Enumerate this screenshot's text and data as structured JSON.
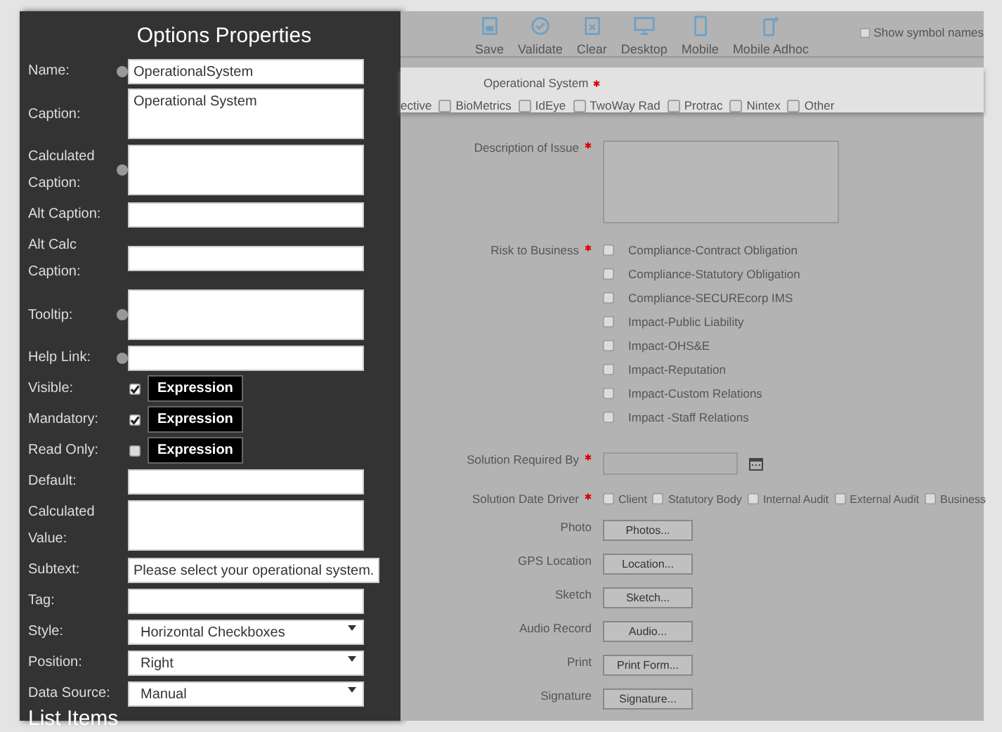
{
  "panel": {
    "title": "Options Properties",
    "fields": [
      {
        "kind": "text",
        "label": "Name:",
        "help": true,
        "value": "OperationalSystem"
      },
      {
        "kind": "textarea",
        "label": "Caption:",
        "help": false,
        "value": "Operational System"
      },
      {
        "kind": "textarea",
        "label": "Calculated Caption:",
        "help": true
      },
      {
        "kind": "text",
        "label": "Alt Caption:",
        "help": false
      },
      {
        "kind": "text",
        "label": "Alt Calc Caption:",
        "help": false
      },
      {
        "kind": "textarea",
        "label": "Tooltip:",
        "help": true
      },
      {
        "kind": "text",
        "label": "Help Link:",
        "help": true
      },
      {
        "kind": "toggle",
        "label": "Visible:",
        "checked": true,
        "button": "Expression"
      },
      {
        "kind": "toggle",
        "label": "Mandatory:",
        "checked": true,
        "button": "Expression"
      },
      {
        "kind": "toggle",
        "label": "Read Only:",
        "checked": false,
        "button": "Expression"
      },
      {
        "kind": "text",
        "label": "Default:",
        "help": false
      },
      {
        "kind": "textarea",
        "label": "Calculated Value:",
        "help": false
      },
      {
        "kind": "text",
        "label": "Subtext:",
        "help": false,
        "value": "Please select your operational system."
      },
      {
        "kind": "text",
        "label": "Tag:",
        "help": false
      },
      {
        "kind": "select",
        "label": "Style:",
        "value": "Horizontal Checkboxes"
      },
      {
        "kind": "select",
        "label": "Position:",
        "value": "Right"
      },
      {
        "kind": "select",
        "label": "Data Source:",
        "value": "Manual"
      }
    ],
    "section": "List Items"
  },
  "toolbar": {
    "items": [
      {
        "kind": "save",
        "label": "Save"
      },
      {
        "kind": "validate",
        "label": "Validate"
      },
      {
        "kind": "clear",
        "label": "Clear"
      },
      {
        "kind": "desktop",
        "label": "Desktop"
      },
      {
        "kind": "mobile",
        "label": "Mobile"
      },
      {
        "kind": "mobile-adhoc",
        "label": "Mobile Adhoc"
      }
    ],
    "option": {
      "label": "Show symbol names",
      "checked": false
    }
  },
  "selected_field": {
    "label": "Operational System",
    "required": true,
    "options": [
      {
        "label": "ective"
      },
      {
        "label": "BioMetrics",
        "checked": false
      },
      {
        "label": "IdEye",
        "checked": false
      },
      {
        "label": "TwoWay Rad",
        "checked": false
      },
      {
        "label": "Protrac",
        "checked": false
      },
      {
        "label": "Nintex",
        "checked": false
      },
      {
        "label": "Other",
        "checked": false
      }
    ]
  },
  "form": [
    {
      "kind": "textarea",
      "label": "Description of Issue",
      "required": true
    },
    {
      "kind": "checklist",
      "label": "Risk to Business",
      "required": true,
      "options": [
        {
          "label": "Compliance-Contract Obligation",
          "checked": false
        },
        {
          "label": "Compliance-Statutory Obligation",
          "checked": false
        },
        {
          "label": "Compliance-SECUREcorp IMS",
          "checked": false
        },
        {
          "label": "Impact-Public Liability",
          "checked": false
        },
        {
          "label": "Impact-OHS&E",
          "checked": false
        },
        {
          "label": "Impact-Reputation",
          "checked": false
        },
        {
          "label": "Impact-Custom Relations",
          "checked": false
        },
        {
          "label": "Impact -Staff Relations",
          "checked": false
        }
      ]
    },
    {
      "kind": "date",
      "label": "Solution Required By",
      "required": true
    },
    {
      "kind": "inline-checks",
      "label": "Solution Date Driver",
      "required": true,
      "options": [
        {
          "label": "Client",
          "checked": false
        },
        {
          "label": "Statutory Body",
          "checked": false
        },
        {
          "label": "Internal Audit",
          "checked": false
        },
        {
          "label": "External Audit",
          "checked": false
        },
        {
          "label": "Business",
          "checked": false
        }
      ]
    },
    {
      "kind": "button",
      "label": "Photo",
      "button": "Photos...",
      "required": false
    },
    {
      "kind": "button",
      "label": "GPS Location",
      "button": "Location...",
      "required": false
    },
    {
      "kind": "button",
      "label": "Sketch",
      "button": "Sketch...",
      "required": false
    },
    {
      "kind": "button",
      "label": "Audio Record",
      "button": "Audio...",
      "required": false
    },
    {
      "kind": "button",
      "label": "Print",
      "button": "Print Form...",
      "required": false
    },
    {
      "kind": "button",
      "label": "Signature",
      "button": "Signature...",
      "required": false
    }
  ]
}
